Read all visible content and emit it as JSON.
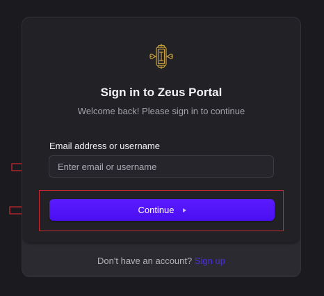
{
  "title": "Sign in to Zeus Portal",
  "subtitle": "Welcome back! Please sign in to continue",
  "form": {
    "email_label": "Email address or username",
    "email_placeholder": "Enter email or username",
    "email_value": "",
    "continue_label": "Continue"
  },
  "footer": {
    "prompt": "Don't have an account?",
    "signup_label": "Sign up"
  },
  "icons": {
    "logo": "ornate-monogram-logo-icon",
    "continue": "play-triangle-icon",
    "annotation_arrow": "red-outline-arrow-icon"
  },
  "colors": {
    "background": "#1b1a1f",
    "card": "#222126",
    "accent": "#5214f9",
    "link": "#4b2fd8",
    "logo_gold": "#c9a23d",
    "annotation": "#c8292f"
  }
}
